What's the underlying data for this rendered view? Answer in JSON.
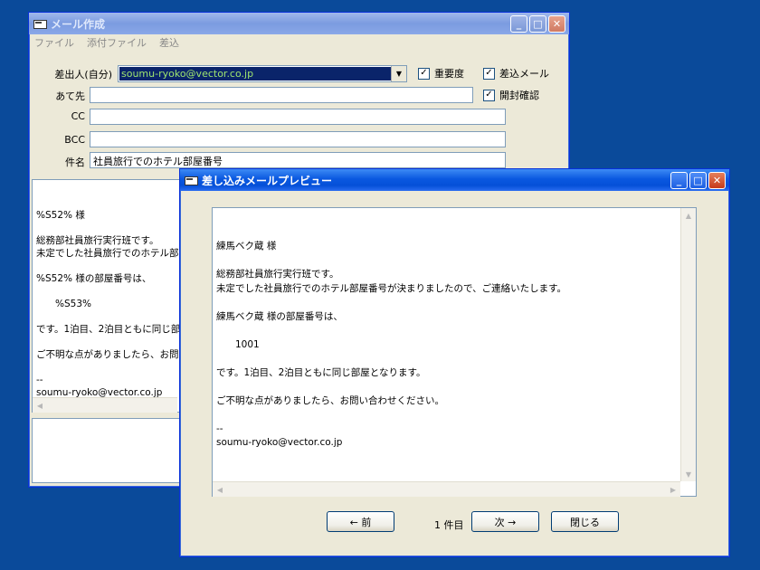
{
  "compose": {
    "title": "メール作成",
    "menu": [
      "ファイル",
      "添付ファイル",
      "差込"
    ],
    "labels": {
      "from": "差出人(自分)",
      "to": "あて先",
      "cc": "CC",
      "bcc": "BCC",
      "subject": "件名"
    },
    "from_value": "soumu-ryoko@vector.co.jp",
    "to_value": "",
    "cc_value": "",
    "bcc_value": "",
    "subject_value": "社員旅行でのホテル部屋番号",
    "checks": {
      "importance": "重要度",
      "merge": "差込メール",
      "read_receipt": "開封確認"
    },
    "body_lines": [
      "%S52% 様",
      "",
      "総務部社員旅行実行班です。",
      "未定でした社員旅行でのホテル部",
      "",
      "%S52% 様の部屋番号は、",
      "",
      "　　%S53%",
      "",
      "です。1泊目、2泊目ともに同じ部",
      "",
      "ご不明な点がありましたら、お問い",
      "",
      "--",
      "soumu-ryoko@vector.co.jp"
    ]
  },
  "preview": {
    "title": "差し込みメールプレビュー",
    "body_lines": [
      "練馬ベク蔵 様",
      "",
      "総務部社員旅行実行班です。",
      "未定でした社員旅行でのホテル部屋番号が決まりましたので、ご連絡いたします。",
      "",
      "練馬ベク蔵 様の部屋番号は、",
      "",
      "　　1001",
      "",
      "です。1泊目、2泊目ともに同じ部屋となります。",
      "",
      "ご不明な点がありましたら、お問い合わせください。",
      "",
      "--",
      "soumu-ryoko@vector.co.jp"
    ],
    "prev_label": "←  前",
    "counter": "1 件目",
    "next_label": "次  →",
    "close_label": "閉じる"
  }
}
